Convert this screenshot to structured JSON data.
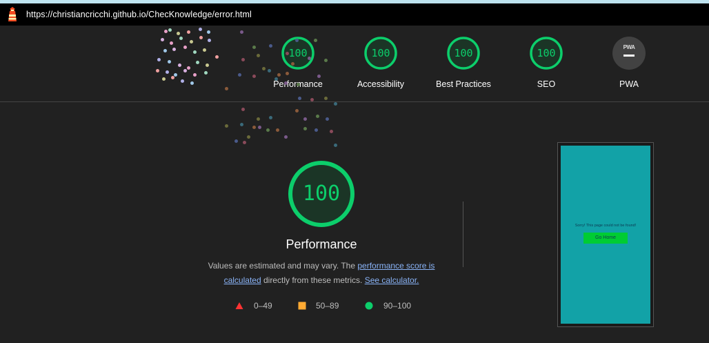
{
  "address_bar": {
    "url": "https://christiancricchi.github.io/ChecKnowledge/error.html"
  },
  "category_gauges": [
    {
      "score": "100",
      "label": "Performance"
    },
    {
      "score": "100",
      "label": "Accessibility"
    },
    {
      "score": "100",
      "label": "Best Practices"
    },
    {
      "score": "100",
      "label": "SEO"
    }
  ],
  "pwa": {
    "badge": "PWA",
    "label": "PWA"
  },
  "performance": {
    "score": "100",
    "title": "Performance",
    "desc_before": "Values are estimated and may vary. The ",
    "desc_link1": "performance score is calculated",
    "desc_middle": " directly from these metrics. ",
    "desc_link2": "See calculator."
  },
  "legend": [
    {
      "shape": "triangle-icon",
      "range": "0–49",
      "color": "#ff3333"
    },
    {
      "shape": "square-icon",
      "range": "50–89",
      "color": "#ffaa33"
    },
    {
      "shape": "circle-icon",
      "range": "90–100",
      "color": "#0cce6b"
    }
  ],
  "screenshot": {
    "message": "Sorry! This page could not be found!",
    "button": "Go Home"
  },
  "colors": {
    "pass": "#0cce6b",
    "background": "#212121",
    "link": "#8ab4f8"
  }
}
